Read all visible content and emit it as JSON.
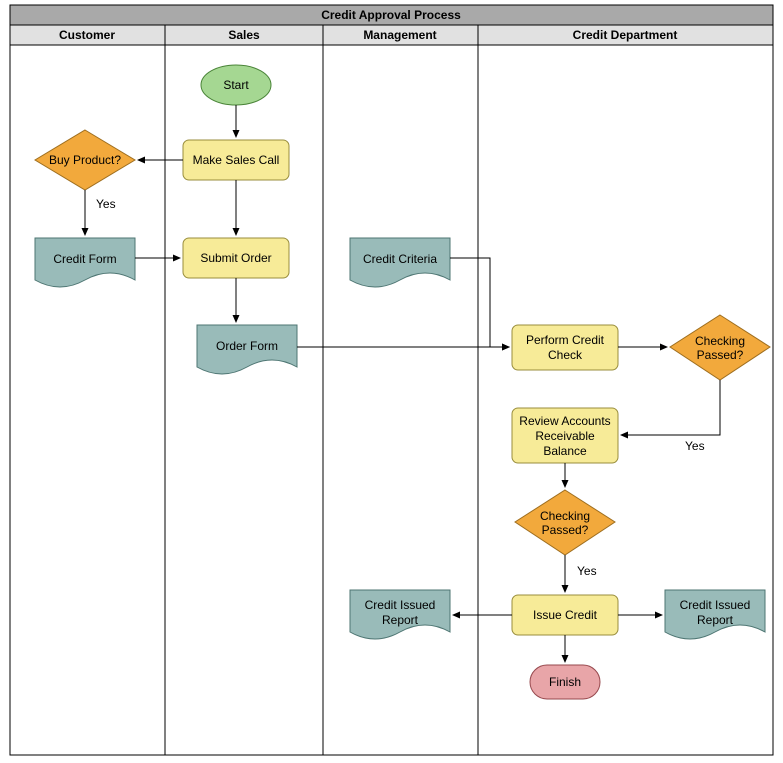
{
  "chart_data": {
    "type": "swimlane-flowchart",
    "title": "Credit Approval Process",
    "lanes": [
      "Customer",
      "Sales",
      "Management",
      "Credit Department"
    ],
    "nodes": [
      {
        "id": "start",
        "lane": "Sales",
        "type": "terminator",
        "label": "Start"
      },
      {
        "id": "makecall",
        "lane": "Sales",
        "type": "process",
        "label": "Make Sales Call"
      },
      {
        "id": "buy",
        "lane": "Customer",
        "type": "decision",
        "label": "Buy Product?"
      },
      {
        "id": "creditform",
        "lane": "Customer",
        "type": "document",
        "label": "Credit Form"
      },
      {
        "id": "submit",
        "lane": "Sales",
        "type": "process",
        "label": "Submit Order"
      },
      {
        "id": "orderform",
        "lane": "Sales",
        "type": "document",
        "label": "Order Form"
      },
      {
        "id": "criteria",
        "lane": "Management",
        "type": "document",
        "label": "Credit Criteria"
      },
      {
        "id": "check",
        "lane": "Credit Department",
        "type": "process",
        "label": "Perform Credit Check"
      },
      {
        "id": "passed1",
        "lane": "Credit Department",
        "type": "decision",
        "label": "Checking Passed?"
      },
      {
        "id": "review",
        "lane": "Credit Department",
        "type": "process",
        "label": "Review Accounts Receivable Balance"
      },
      {
        "id": "passed2",
        "lane": "Credit Department",
        "type": "decision",
        "label": "Checking Passed?"
      },
      {
        "id": "issue",
        "lane": "Credit Department",
        "type": "process",
        "label": "Issue Credit"
      },
      {
        "id": "report1",
        "lane": "Management",
        "type": "document",
        "label": "Credit Issued Report"
      },
      {
        "id": "report2",
        "lane": "Credit Department",
        "type": "document",
        "label": "Credit Issued Report"
      },
      {
        "id": "finish",
        "lane": "Credit Department",
        "type": "terminator",
        "label": "Finish"
      }
    ],
    "edges": [
      {
        "from": "start",
        "to": "makecall"
      },
      {
        "from": "makecall",
        "to": "buy"
      },
      {
        "from": "buy",
        "to": "creditform",
        "label": "Yes"
      },
      {
        "from": "creditform",
        "to": "submit"
      },
      {
        "from": "makecall",
        "to": "submit"
      },
      {
        "from": "submit",
        "to": "orderform"
      },
      {
        "from": "orderform",
        "to": "check"
      },
      {
        "from": "criteria",
        "to": "check"
      },
      {
        "from": "check",
        "to": "passed1"
      },
      {
        "from": "passed1",
        "to": "review",
        "label": "Yes"
      },
      {
        "from": "review",
        "to": "passed2"
      },
      {
        "from": "passed2",
        "to": "issue",
        "label": "Yes"
      },
      {
        "from": "issue",
        "to": "report1"
      },
      {
        "from": "issue",
        "to": "report2"
      },
      {
        "from": "issue",
        "to": "finish"
      }
    ]
  },
  "title": "Credit Approval Process",
  "lanes": {
    "customer": "Customer",
    "sales": "Sales",
    "management": "Management",
    "credit": "Credit Department"
  },
  "nodes": {
    "start": "Start",
    "makecall": "Make Sales Call",
    "buyL1": "Buy Product?",
    "creditform": "Credit Form",
    "submit": "Submit Order",
    "orderform": "Order Form",
    "criteria": "Credit Criteria",
    "checkL1": "Perform Credit",
    "checkL2": "Check",
    "passed1L1": "Checking",
    "passed1L2": "Passed?",
    "reviewL1": "Review Accounts",
    "reviewL2": "Receivable",
    "reviewL3": "Balance",
    "passed2L1": "Checking",
    "passed2L2": "Passed?",
    "issue": "Issue Credit",
    "report1L1": "Credit Issued",
    "report1L2": "Report",
    "report2L1": "Credit Issued",
    "report2L2": "Report",
    "finish": "Finish"
  },
  "labels": {
    "yes": "Yes"
  }
}
